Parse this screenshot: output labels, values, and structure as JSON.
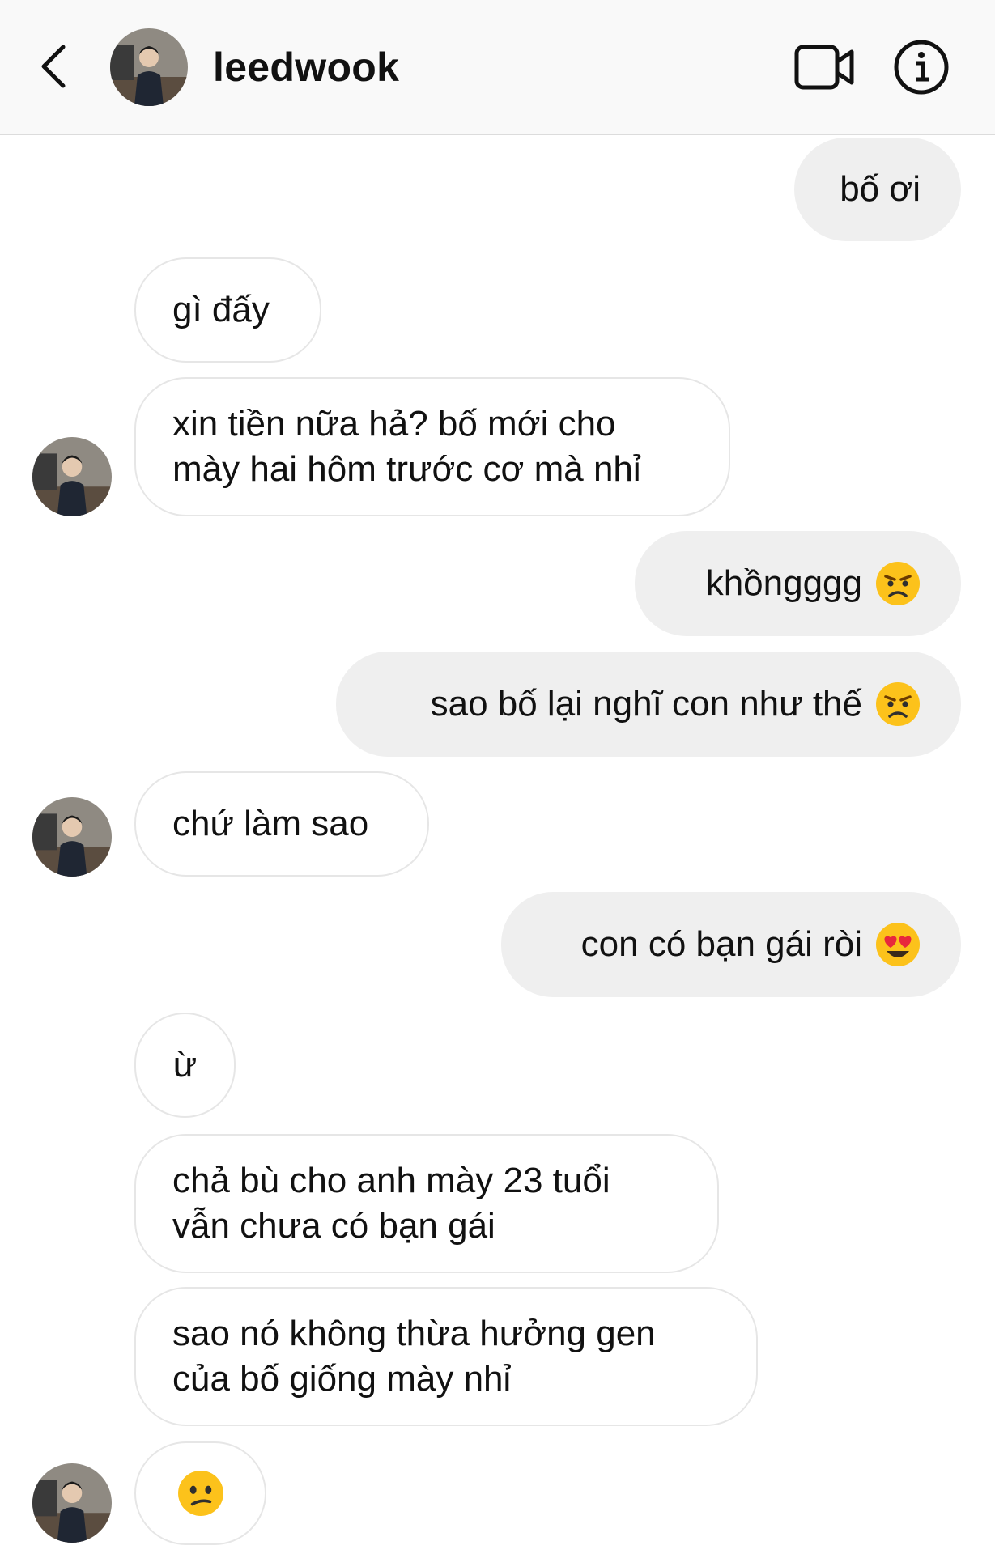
{
  "header": {
    "username": "leedwook",
    "back_icon": "chevron-left-icon",
    "video_icon": "video-camera-icon",
    "info_icon": "info-icon"
  },
  "messages": [
    {
      "from": "me",
      "text": "bố ơi"
    },
    {
      "from": "them",
      "text": "gì đấy"
    },
    {
      "from": "them",
      "lines": [
        "xin tiền nữa hả? bố mới cho",
        "mày hai hôm trước cơ mà nhỉ"
      ]
    },
    {
      "from": "me",
      "text": "khồngggg",
      "emoji": "angry-face-emoji"
    },
    {
      "from": "me",
      "text": "sao bố lại nghĩ con như thế",
      "emoji": "angry-face-emoji"
    },
    {
      "from": "them",
      "text": "chứ làm sao"
    },
    {
      "from": "me",
      "text": "con có bạn gái ròi",
      "emoji": "heart-eyes-emoji"
    },
    {
      "from": "them",
      "text": "ừ"
    },
    {
      "from": "them",
      "lines": [
        "chả bù cho anh mày 23 tuổi",
        "vẫn chưa có bạn gái"
      ]
    },
    {
      "from": "them",
      "lines": [
        "sao nó không thừa hưởng gen",
        "của bố giống mày nhỉ"
      ]
    },
    {
      "from": "them",
      "emoji": "confused-face-emoji"
    }
  ],
  "colors": {
    "header_bg": "#f9f9f9",
    "outgoing_bubble": "#efefef",
    "incoming_border": "#e6e6e6",
    "emoji_yellow": "#fcc21b"
  }
}
